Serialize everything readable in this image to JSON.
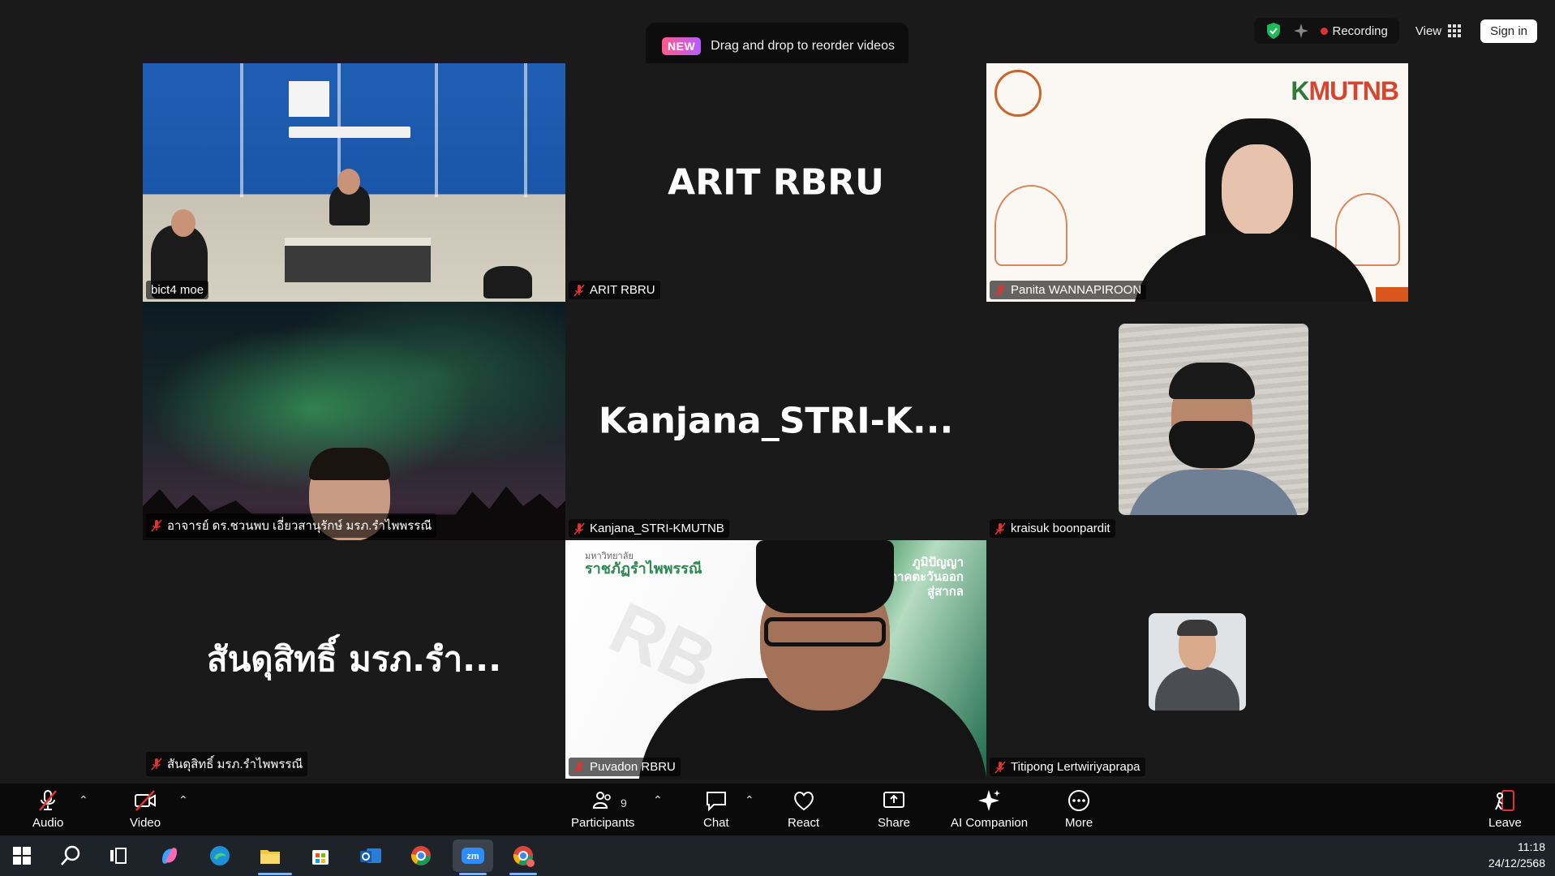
{
  "banner": {
    "badge": "NEW",
    "text": "Drag and drop to reorder videos"
  },
  "topbar": {
    "recording_label": "Recording",
    "view_label": "View",
    "signin_label": "Sign in"
  },
  "tiles": [
    {
      "name": "bict4 moe",
      "muted": false,
      "active": true
    },
    {
      "name": "ARIT RBRU",
      "display": "ARIT RBRU",
      "muted": true
    },
    {
      "name": "Panita WANNAPIROON",
      "muted": true
    },
    {
      "name": "อาจารย์ ดร.ชวนพบ เอี่ยวสานุรักษ์ มรภ.รำไพพรรณี",
      "muted": true
    },
    {
      "name": "Kanjana_STRI-KMUTNB",
      "display": "Kanjana_STRI-K...",
      "muted": true
    },
    {
      "name": "kraisuk boonpardit",
      "muted": true
    },
    {
      "name": "สันดุสิทธิ์ มรภ.รำไพพรรณี",
      "display": "สันดุสิทธิ์ มรภ.รำ...",
      "muted": true
    },
    {
      "name": "Puvadon RBRU",
      "muted": true
    },
    {
      "name": "Titipong Lertwiriyaprapa",
      "muted": true
    }
  ],
  "kmutnb_logo": {
    "k": "K",
    "rest": "MUTNB"
  },
  "rbru": {
    "title_line1": "มหาวิทยาลัย",
    "title_line2": "ราชภัฏรำไพพรรณี",
    "tag1": "ภูมิปัญญา",
    "tag2": "ภาคตะวันออก",
    "tag3": "สู่สากล"
  },
  "controls": {
    "audio": "Audio",
    "video": "Video",
    "participants": "Participants",
    "participants_count": "9",
    "chat": "Chat",
    "react": "React",
    "share": "Share",
    "ai_companion": "AI Companion",
    "more": "More",
    "leave": "Leave"
  },
  "clock": {
    "time": "11:18",
    "date": "24/12/2568"
  },
  "colors": {
    "active_border": "#2bd47c",
    "muted_red": "#e0322f",
    "recording": "#e0322f"
  }
}
